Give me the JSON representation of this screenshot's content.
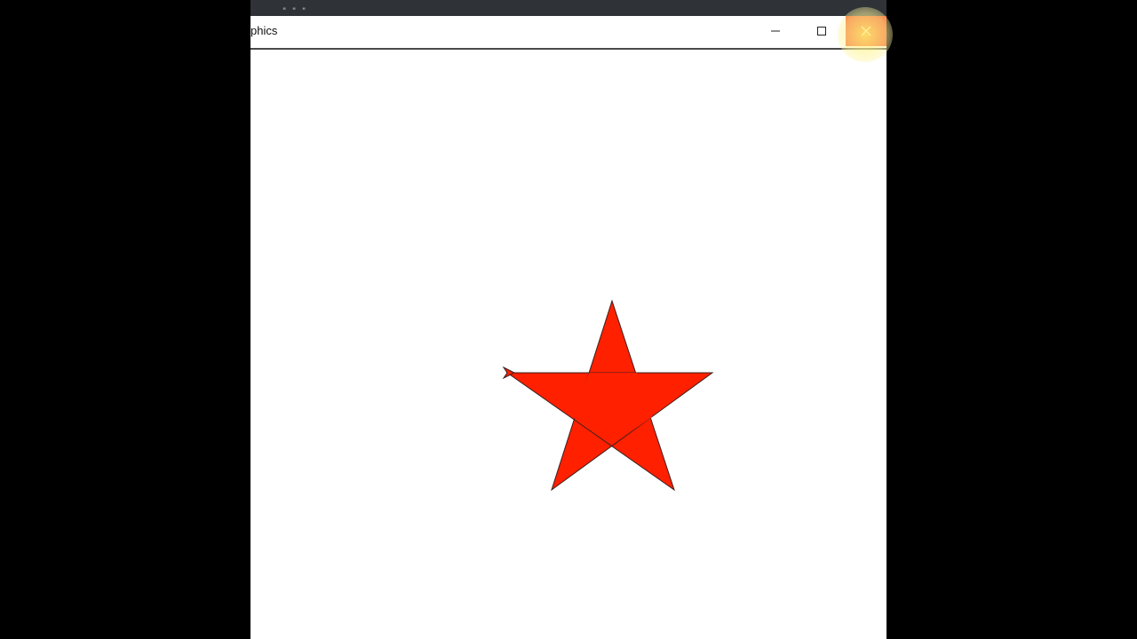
{
  "window": {
    "title": "phics",
    "controls": {
      "minimize_icon": "minimize-icon",
      "maximize_icon": "maximize-icon",
      "close_icon": "close-icon"
    }
  },
  "background_dots": "\" \" \"",
  "canvas": {
    "shape": "five-pointed-star",
    "fill_color": "#ff2000",
    "stroke_color": "#3a2020",
    "turtle_cursor": "turtle-arrow-icon"
  },
  "colors": {
    "close_button": "#f04f1c",
    "titlebar_border": "#4a4a4a",
    "canvas_background": "#ffffff"
  }
}
